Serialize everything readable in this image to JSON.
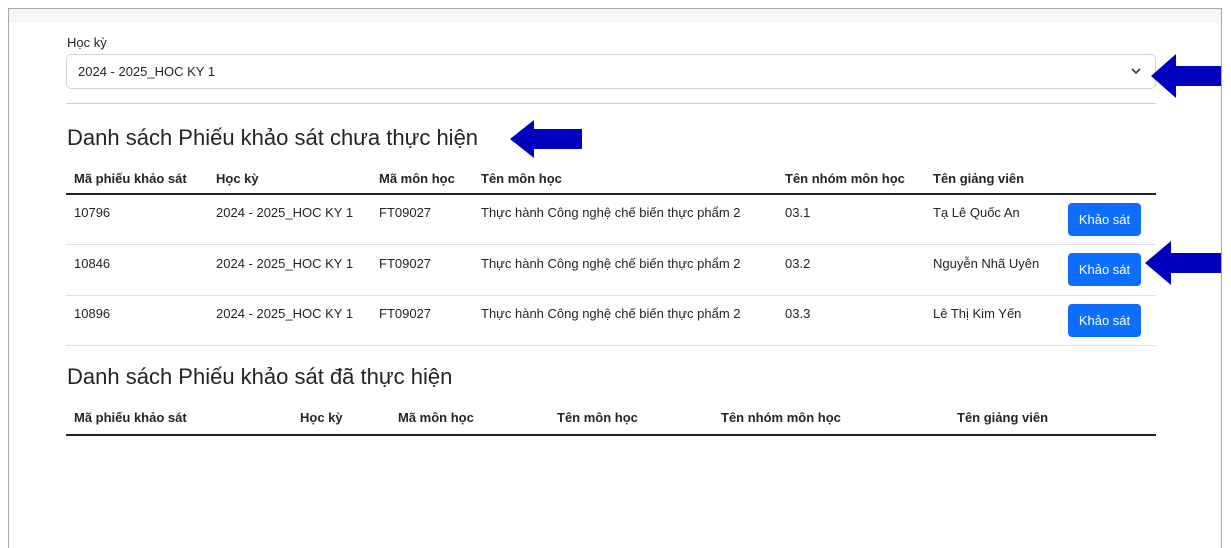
{
  "semester": {
    "label": "Học kỳ",
    "selected": "2024 - 2025_HOC KY 1"
  },
  "pending": {
    "title": "Danh sách Phiếu khảo sát chưa thực hiện",
    "columns": [
      "Mã phiếu khảo sát",
      "Học kỳ",
      "Mã môn học",
      "Tên môn học",
      "Tên nhóm môn học",
      "Tên giảng viên"
    ],
    "rows": [
      {
        "id": "10796",
        "semester": "2024 - 2025_HOC KY 1",
        "course_code": "FT09027",
        "course_name": "Thực hành Công nghệ chế biến thực phẩm 2",
        "group": "03.1",
        "lecturer": "Tạ Lê Quốc An",
        "action": "Khảo sát"
      },
      {
        "id": "10846",
        "semester": "2024 - 2025_HOC KY 1",
        "course_code": "FT09027",
        "course_name": "Thực hành Công nghệ chế biến thực phẩm 2",
        "group": "03.2",
        "lecturer": "Nguyễn Nhã Uyên",
        "action": "Khảo sát"
      },
      {
        "id": "10896",
        "semester": "2024 - 2025_HOC KY 1",
        "course_code": "FT09027",
        "course_name": "Thực hành Công nghệ chế biến thực phẩm 2",
        "group": "03.3",
        "lecturer": "Lê Thị Kim Yến",
        "action": "Khảo sát"
      }
    ]
  },
  "completed": {
    "title": "Danh sách Phiếu khảo sát đã thực hiện",
    "columns": [
      "Mã phiếu khảo sát",
      "Học kỳ",
      "Mã môn học",
      "Tên môn học",
      "Tên nhóm môn học",
      "Tên giảng viên"
    ]
  },
  "colors": {
    "primary_button": "#0d6efd",
    "annotation_arrow": "#0000c0"
  }
}
